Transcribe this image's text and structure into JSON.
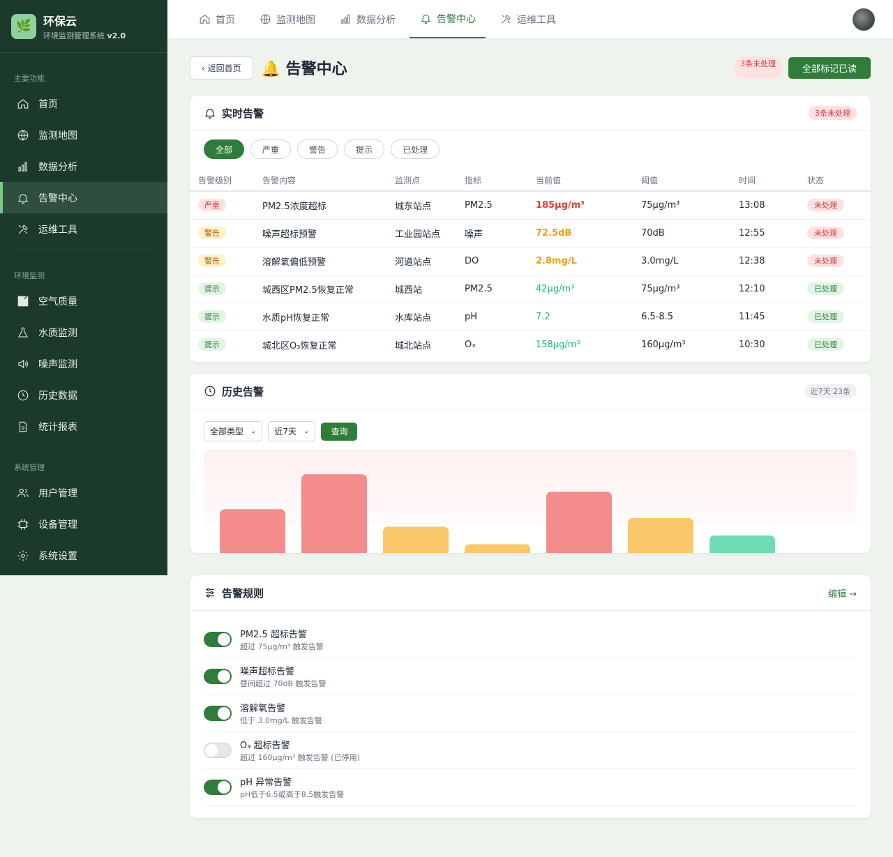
{
  "brand": {
    "name": "环保云",
    "subtitle": "环境监测管理系统",
    "version": "v2.0",
    "logo_glyph": "🌿"
  },
  "sidebar": {
    "sections": [
      {
        "title": "主要功能",
        "items": [
          {
            "label": "首页",
            "icon": "home-icon"
          },
          {
            "label": "监测地图",
            "icon": "globe-icon"
          },
          {
            "label": "数据分析",
            "icon": "bar-chart-icon"
          },
          {
            "label": "告警中心",
            "icon": "bell-icon",
            "active": true
          },
          {
            "label": "运维工具",
            "icon": "tools-icon"
          }
        ]
      },
      {
        "title": "环境监测",
        "items": [
          {
            "label": "空气质量",
            "icon": "square-icon"
          },
          {
            "label": "水质监测",
            "icon": "flask-icon"
          },
          {
            "label": "噪声监测",
            "icon": "speaker-icon"
          },
          {
            "label": "历史数据",
            "icon": "clock-icon"
          },
          {
            "label": "统计报表",
            "icon": "document-icon"
          }
        ]
      },
      {
        "title": "系统管理",
        "items": [
          {
            "label": "用户管理",
            "icon": "users-icon"
          },
          {
            "label": "设备管理",
            "icon": "chip-icon"
          },
          {
            "label": "系统设置",
            "icon": "gear-icon"
          }
        ]
      }
    ]
  },
  "topbar": {
    "tabs": [
      {
        "label": "首页",
        "icon": "home-icon"
      },
      {
        "label": "监测地图",
        "icon": "globe-icon"
      },
      {
        "label": "数据分析",
        "icon": "bar-chart-icon"
      },
      {
        "label": "告警中心",
        "icon": "bell-icon",
        "active": true
      },
      {
        "label": "运维工具",
        "icon": "tools-icon"
      }
    ]
  },
  "page": {
    "back_label": "‹ 返回首页",
    "title": "🔔 告警中心",
    "unread_pill": "3条未处理",
    "primary_action": "全部标记已读"
  },
  "alerts": {
    "title": "实时告警",
    "badge": "3条未处理",
    "filters": [
      "全部",
      "严重",
      "警告",
      "提示",
      "已处理"
    ],
    "columns": [
      "告警级别",
      "告警内容",
      "监测点",
      "指标",
      "当前值",
      "阈值",
      "时间",
      "状态"
    ],
    "rows": [
      {
        "level": "严重",
        "level_type": "red",
        "content": "PM2.5浓度超标",
        "site": "城东站点",
        "metric": "PM2.5",
        "value": "185μg/m³",
        "value_type": "red",
        "threshold": "75μg/m³",
        "time": "13:08",
        "status": "未处理",
        "status_type": "red"
      },
      {
        "level": "警告",
        "level_type": "yellow",
        "content": "噪声超标预警",
        "site": "工业园站点",
        "metric": "噪声",
        "value": "72.5dB",
        "value_type": "orange",
        "threshold": "70dB",
        "time": "12:55",
        "status": "未处理",
        "status_type": "red"
      },
      {
        "level": "警告",
        "level_type": "yellow",
        "content": "溶解氧偏低预警",
        "site": "河道站点",
        "metric": "DO",
        "value": "2.8mg/L",
        "value_type": "orange",
        "threshold": "3.0mg/L",
        "time": "12:38",
        "status": "未处理",
        "status_type": "red"
      },
      {
        "level": "提示",
        "level_type": "green",
        "content": "城西区PM2.5恢复正常",
        "site": "城西站",
        "metric": "PM2.5",
        "value": "42μg/m³",
        "value_type": "green",
        "threshold": "75μg/m³",
        "time": "12:10",
        "status": "已处理",
        "status_type": "green"
      },
      {
        "level": "提示",
        "level_type": "green",
        "content": "水质pH恢复正常",
        "site": "水库站点",
        "metric": "pH",
        "value": "7.2",
        "value_type": "green",
        "threshold": "6.5-8.5",
        "time": "11:45",
        "status": "已处理",
        "status_type": "green"
      },
      {
        "level": "提示",
        "level_type": "green",
        "content": "城北区O₃恢复正常",
        "site": "城北站点",
        "metric": "O₃",
        "value": "158μg/m³",
        "value_type": "green",
        "threshold": "160μg/m³",
        "time": "10:30",
        "status": "已处理",
        "status_type": "green"
      }
    ]
  },
  "history": {
    "title": "历史告警",
    "badge": "近7天 23条",
    "type_select": "全部类型",
    "range_select": "近7天",
    "query_label": "查询"
  },
  "chart_data": {
    "type": "bar",
    "categories": [
      "",
      "",
      "",
      "",
      "",
      "",
      "",
      ""
    ],
    "values": [
      5,
      9,
      3,
      1,
      7,
      4,
      2,
      0
    ],
    "colors": [
      "#f48c8c",
      "#f48c8c",
      "#fac769",
      "#fac769",
      "#f48c8c",
      "#fac769",
      "#6fdcb4",
      "#6fdcb4"
    ],
    "ylim": [
      0,
      11
    ],
    "title": "",
    "xlabel": "",
    "ylabel": ""
  },
  "rules": {
    "title": "告警规则",
    "edit_label": "编辑 →",
    "items": [
      {
        "title": "PM2.5 超标告警",
        "desc": "超过 75μg/m³ 触发告警",
        "enabled": true
      },
      {
        "title": "噪声超标告警",
        "desc": "昼间超过 70dB 触发告警",
        "enabled": true
      },
      {
        "title": "溶解氧告警",
        "desc": "低于 3.0mg/L 触发告警",
        "enabled": true
      },
      {
        "title": "O₃ 超标告警",
        "desc": "超过 160μg/m³ 触发告警 (已停用)",
        "enabled": false
      },
      {
        "title": "pH 异常告警",
        "desc": "pH低于6.5或高于8.5触发告警",
        "enabled": true
      }
    ]
  },
  "colors": {
    "sidebar": "#1c3a2c",
    "accent": "#2f7d3a",
    "danger": "#d9363e"
  }
}
